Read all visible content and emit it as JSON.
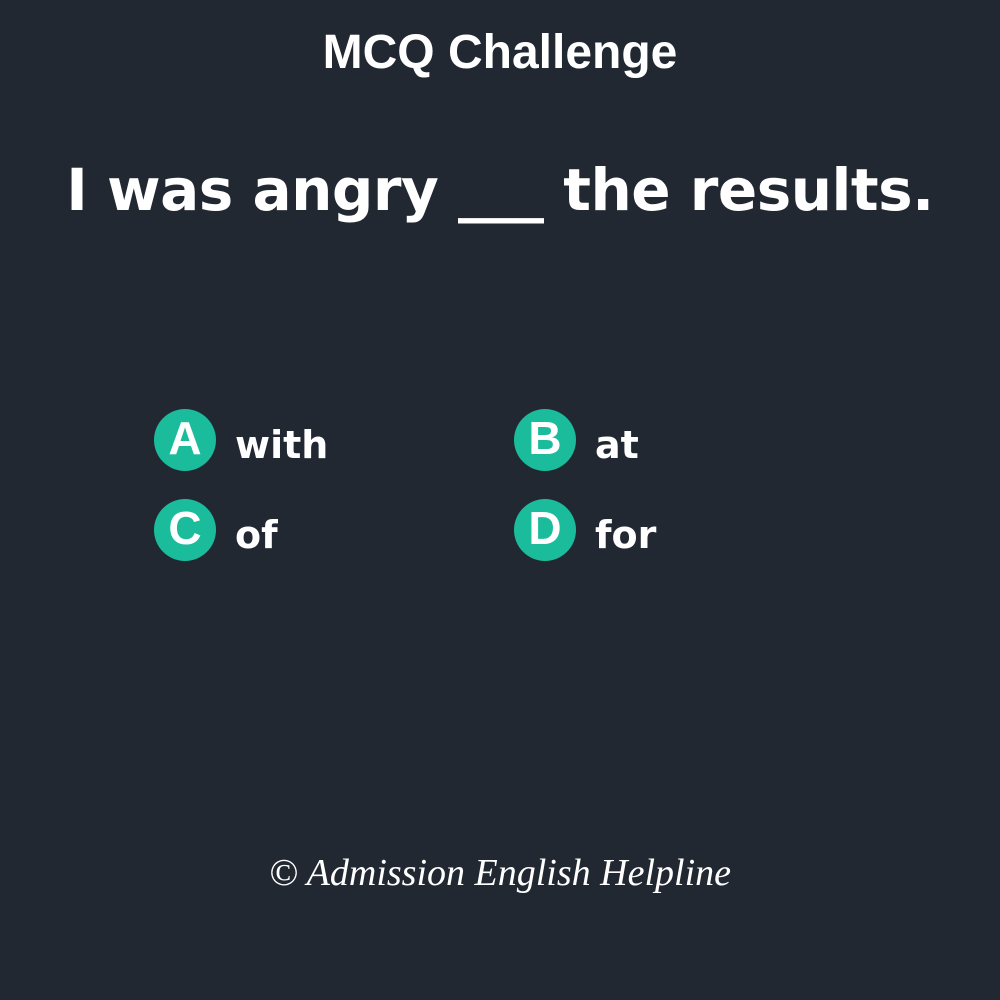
{
  "title": "MCQ Challenge",
  "question": "I was angry ___ the results.",
  "options": [
    {
      "letter": "A",
      "text": "with"
    },
    {
      "letter": "B",
      "text": "at"
    },
    {
      "letter": "C",
      "text": "of"
    },
    {
      "letter": "D",
      "text": "for"
    }
  ],
  "footer": "© Admission English Helpline",
  "colors": {
    "background": "#222831",
    "accent": "#1abc9c",
    "text": "#ffffff"
  }
}
